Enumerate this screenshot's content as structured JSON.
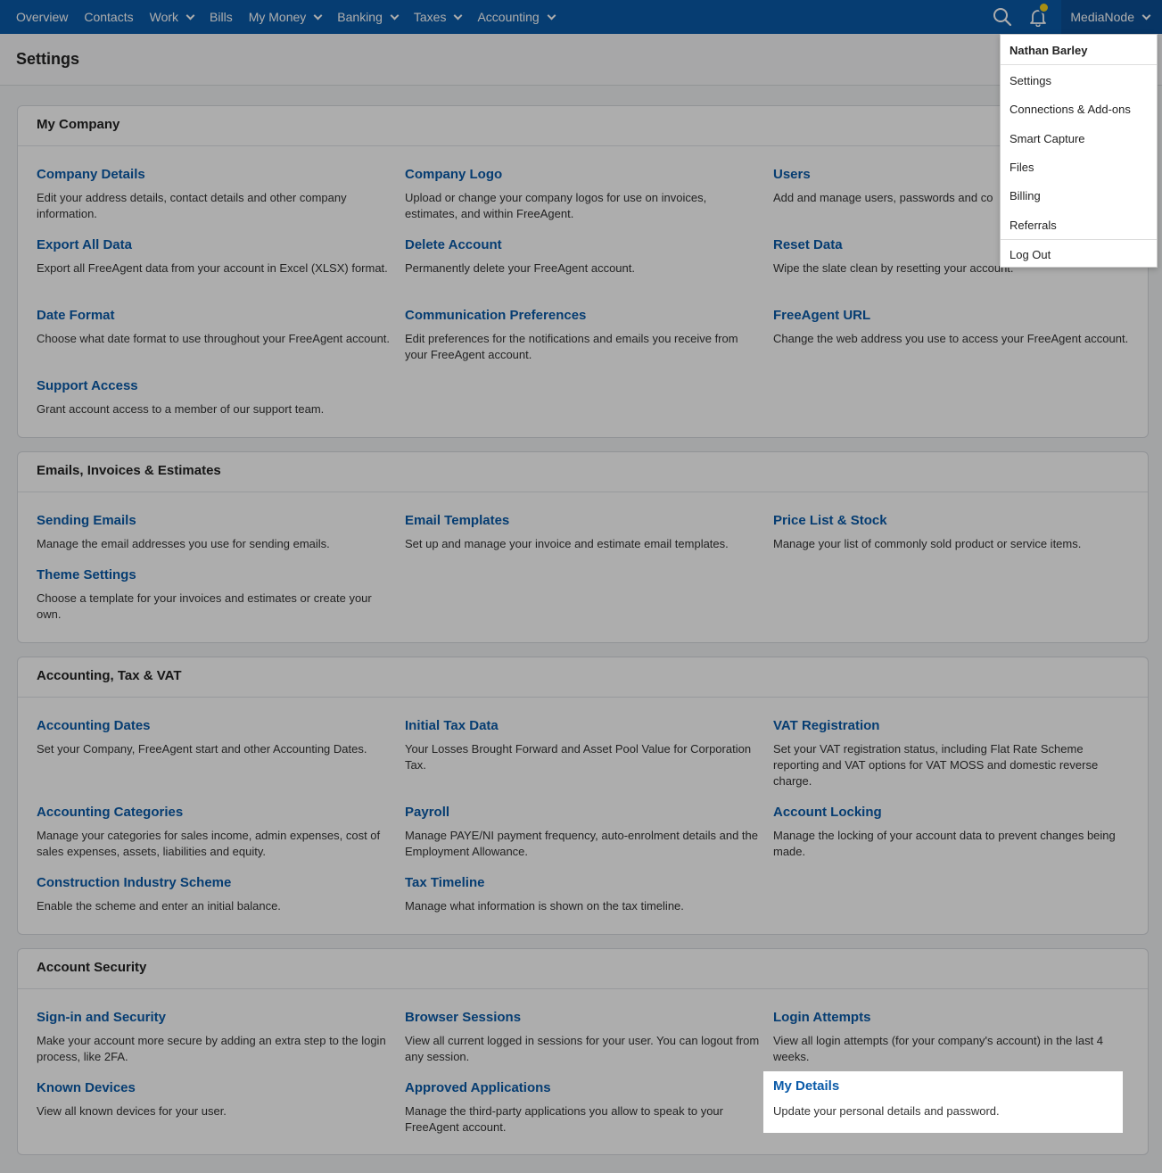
{
  "nav": {
    "items": [
      {
        "label": "Overview",
        "dropdown": false
      },
      {
        "label": "Contacts",
        "dropdown": false
      },
      {
        "label": "Work",
        "dropdown": true
      },
      {
        "label": "Bills",
        "dropdown": false
      },
      {
        "label": "My Money",
        "dropdown": true
      },
      {
        "label": "Banking",
        "dropdown": true
      },
      {
        "label": "Taxes",
        "dropdown": true
      },
      {
        "label": "Accounting",
        "dropdown": true
      }
    ],
    "account": "MediaNode"
  },
  "page": {
    "title": "Settings"
  },
  "sections": [
    {
      "title": "My Company",
      "items": [
        {
          "title": "Company Details",
          "desc": "Edit your address details, contact details and other company information."
        },
        {
          "title": "Company Logo",
          "desc": "Upload or change your company logos for use on invoices, estimates, and within FreeAgent."
        },
        {
          "title": "Users",
          "desc": "Add and manage users, passwords and co"
        },
        {
          "title": "Export All Data",
          "desc": "Export all FreeAgent data from your account in Excel (XLSX) format."
        },
        {
          "title": "Delete Account",
          "desc": "Permanently delete your FreeAgent account."
        },
        {
          "title": "Reset Data",
          "desc": "Wipe the slate clean by resetting your account."
        },
        {
          "title": "Date Format",
          "desc": "Choose what date format to use throughout your FreeAgent account."
        },
        {
          "title": "Communication Preferences",
          "desc": "Edit preferences for the notifications and emails you receive from your FreeAgent account."
        },
        {
          "title": "FreeAgent URL",
          "desc": "Change the web address you use to access your FreeAgent account."
        },
        {
          "title": "Support Access",
          "desc": "Grant account access to a member of our support team."
        }
      ]
    },
    {
      "title": "Emails, Invoices & Estimates",
      "items": [
        {
          "title": "Sending Emails",
          "desc": "Manage the email addresses you use for sending emails."
        },
        {
          "title": "Email Templates",
          "desc": "Set up and manage your invoice and estimate email templates."
        },
        {
          "title": "Price List & Stock",
          "desc": "Manage your list of commonly sold product or service items."
        },
        {
          "title": "Theme Settings",
          "desc": "Choose a template for your invoices and estimates or create your own."
        }
      ]
    },
    {
      "title": "Accounting, Tax & VAT",
      "items": [
        {
          "title": "Accounting Dates",
          "desc": "Set your Company, FreeAgent start and other Accounting Dates."
        },
        {
          "title": "Initial Tax Data",
          "desc": "Your Losses Brought Forward and Asset Pool Value for Corporation Tax."
        },
        {
          "title": "VAT Registration",
          "desc": "Set your VAT registration status, including Flat Rate Scheme reporting and VAT options for VAT MOSS and domestic reverse charge."
        },
        {
          "title": "Accounting Categories",
          "desc": "Manage your categories for sales income, admin expenses, cost of sales expenses, assets, liabilities and equity."
        },
        {
          "title": "Payroll",
          "desc": "Manage PAYE/NI payment frequency, auto-enrolment details and the Employment Allowance."
        },
        {
          "title": "Account Locking",
          "desc": "Manage the locking of your account data to prevent changes being made."
        },
        {
          "title": "Construction Industry Scheme",
          "desc": "Enable the scheme and enter an initial balance."
        },
        {
          "title": "Tax Timeline",
          "desc": "Manage what information is shown on the tax timeline."
        }
      ]
    },
    {
      "title": "Account Security",
      "items": [
        {
          "title": "Sign-in and Security",
          "desc": "Make your account more secure by adding an extra step to the login process, like 2FA."
        },
        {
          "title": "Browser Sessions",
          "desc": "View all current logged in sessions for your user. You can logout from any session."
        },
        {
          "title": "Login Attempts",
          "desc": "View all login attempts (for your company's account) in the last 4 weeks."
        },
        {
          "title": "Known Devices",
          "desc": "View all known devices for your user."
        },
        {
          "title": "Approved Applications",
          "desc": "Manage the third-party applications you allow to speak to your FreeAgent account."
        }
      ]
    }
  ],
  "highlight": {
    "title": "My Details",
    "desc": "Update your personal details and password."
  },
  "menu": {
    "user_name": "Nathan Barley",
    "items": [
      "Settings",
      "Connections & Add-ons",
      "Smart Capture",
      "Files",
      "Billing",
      "Referrals",
      "Log Out"
    ]
  },
  "colors": {
    "nav": "#0a5aa8",
    "link": "#0a5aa8",
    "bell_badge": "#f5d21c"
  }
}
